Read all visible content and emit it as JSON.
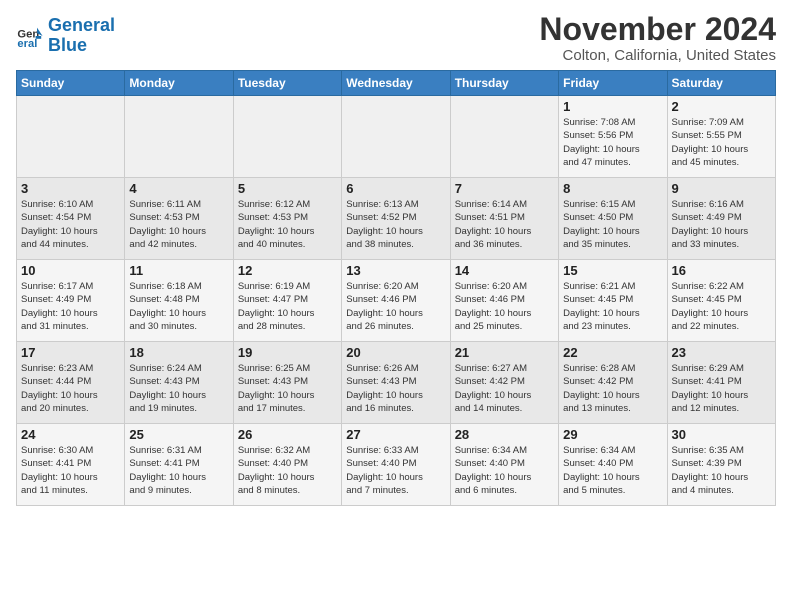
{
  "header": {
    "logo_line1": "General",
    "logo_line2": "Blue",
    "month": "November 2024",
    "location": "Colton, California, United States"
  },
  "weekdays": [
    "Sunday",
    "Monday",
    "Tuesday",
    "Wednesday",
    "Thursday",
    "Friday",
    "Saturday"
  ],
  "weeks": [
    [
      {
        "day": "",
        "info": ""
      },
      {
        "day": "",
        "info": ""
      },
      {
        "day": "",
        "info": ""
      },
      {
        "day": "",
        "info": ""
      },
      {
        "day": "",
        "info": ""
      },
      {
        "day": "1",
        "info": "Sunrise: 7:08 AM\nSunset: 5:56 PM\nDaylight: 10 hours\nand 47 minutes."
      },
      {
        "day": "2",
        "info": "Sunrise: 7:09 AM\nSunset: 5:55 PM\nDaylight: 10 hours\nand 45 minutes."
      }
    ],
    [
      {
        "day": "3",
        "info": "Sunrise: 6:10 AM\nSunset: 4:54 PM\nDaylight: 10 hours\nand 44 minutes."
      },
      {
        "day": "4",
        "info": "Sunrise: 6:11 AM\nSunset: 4:53 PM\nDaylight: 10 hours\nand 42 minutes."
      },
      {
        "day": "5",
        "info": "Sunrise: 6:12 AM\nSunset: 4:53 PM\nDaylight: 10 hours\nand 40 minutes."
      },
      {
        "day": "6",
        "info": "Sunrise: 6:13 AM\nSunset: 4:52 PM\nDaylight: 10 hours\nand 38 minutes."
      },
      {
        "day": "7",
        "info": "Sunrise: 6:14 AM\nSunset: 4:51 PM\nDaylight: 10 hours\nand 36 minutes."
      },
      {
        "day": "8",
        "info": "Sunrise: 6:15 AM\nSunset: 4:50 PM\nDaylight: 10 hours\nand 35 minutes."
      },
      {
        "day": "9",
        "info": "Sunrise: 6:16 AM\nSunset: 4:49 PM\nDaylight: 10 hours\nand 33 minutes."
      }
    ],
    [
      {
        "day": "10",
        "info": "Sunrise: 6:17 AM\nSunset: 4:49 PM\nDaylight: 10 hours\nand 31 minutes."
      },
      {
        "day": "11",
        "info": "Sunrise: 6:18 AM\nSunset: 4:48 PM\nDaylight: 10 hours\nand 30 minutes."
      },
      {
        "day": "12",
        "info": "Sunrise: 6:19 AM\nSunset: 4:47 PM\nDaylight: 10 hours\nand 28 minutes."
      },
      {
        "day": "13",
        "info": "Sunrise: 6:20 AM\nSunset: 4:46 PM\nDaylight: 10 hours\nand 26 minutes."
      },
      {
        "day": "14",
        "info": "Sunrise: 6:20 AM\nSunset: 4:46 PM\nDaylight: 10 hours\nand 25 minutes."
      },
      {
        "day": "15",
        "info": "Sunrise: 6:21 AM\nSunset: 4:45 PM\nDaylight: 10 hours\nand 23 minutes."
      },
      {
        "day": "16",
        "info": "Sunrise: 6:22 AM\nSunset: 4:45 PM\nDaylight: 10 hours\nand 22 minutes."
      }
    ],
    [
      {
        "day": "17",
        "info": "Sunrise: 6:23 AM\nSunset: 4:44 PM\nDaylight: 10 hours\nand 20 minutes."
      },
      {
        "day": "18",
        "info": "Sunrise: 6:24 AM\nSunset: 4:43 PM\nDaylight: 10 hours\nand 19 minutes."
      },
      {
        "day": "19",
        "info": "Sunrise: 6:25 AM\nSunset: 4:43 PM\nDaylight: 10 hours\nand 17 minutes."
      },
      {
        "day": "20",
        "info": "Sunrise: 6:26 AM\nSunset: 4:43 PM\nDaylight: 10 hours\nand 16 minutes."
      },
      {
        "day": "21",
        "info": "Sunrise: 6:27 AM\nSunset: 4:42 PM\nDaylight: 10 hours\nand 14 minutes."
      },
      {
        "day": "22",
        "info": "Sunrise: 6:28 AM\nSunset: 4:42 PM\nDaylight: 10 hours\nand 13 minutes."
      },
      {
        "day": "23",
        "info": "Sunrise: 6:29 AM\nSunset: 4:41 PM\nDaylight: 10 hours\nand 12 minutes."
      }
    ],
    [
      {
        "day": "24",
        "info": "Sunrise: 6:30 AM\nSunset: 4:41 PM\nDaylight: 10 hours\nand 11 minutes."
      },
      {
        "day": "25",
        "info": "Sunrise: 6:31 AM\nSunset: 4:41 PM\nDaylight: 10 hours\nand 9 minutes."
      },
      {
        "day": "26",
        "info": "Sunrise: 6:32 AM\nSunset: 4:40 PM\nDaylight: 10 hours\nand 8 minutes."
      },
      {
        "day": "27",
        "info": "Sunrise: 6:33 AM\nSunset: 4:40 PM\nDaylight: 10 hours\nand 7 minutes."
      },
      {
        "day": "28",
        "info": "Sunrise: 6:34 AM\nSunset: 4:40 PM\nDaylight: 10 hours\nand 6 minutes."
      },
      {
        "day": "29",
        "info": "Sunrise: 6:34 AM\nSunset: 4:40 PM\nDaylight: 10 hours\nand 5 minutes."
      },
      {
        "day": "30",
        "info": "Sunrise: 6:35 AM\nSunset: 4:39 PM\nDaylight: 10 hours\nand 4 minutes."
      }
    ]
  ]
}
